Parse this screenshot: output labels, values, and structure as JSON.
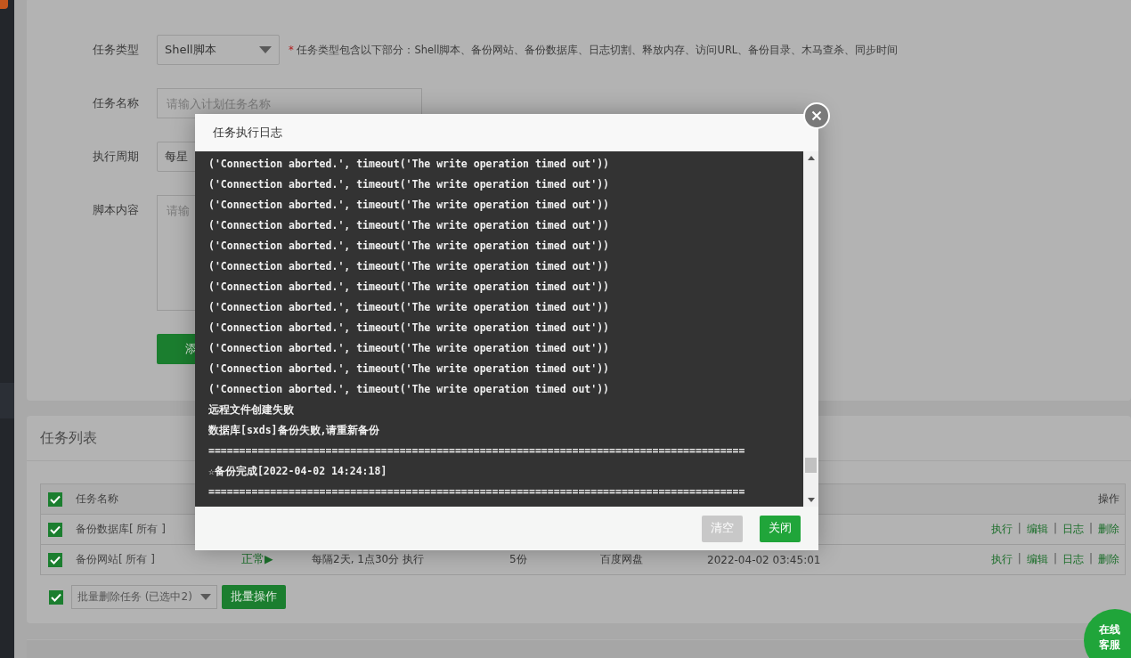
{
  "form": {
    "fields": [
      {
        "label": "任务类型",
        "kind": "select",
        "value": "Shell脚本",
        "note_mark": "*",
        "note": "任务类型包含以下部分：Shell脚本、备份网站、备份数据库、日志切割、释放内存、访问URL、备份目录、木马查杀、同步时间"
      },
      {
        "label": "任务名称",
        "kind": "input",
        "placeholder": "请输入计划任务名称"
      },
      {
        "label": "执行周期",
        "kind": "select",
        "value": "每星"
      },
      {
        "label": "脚本内容",
        "kind": "textarea",
        "placeholder": "请输"
      }
    ],
    "submit": "添"
  },
  "task_list": {
    "title": "任务列表",
    "columns": [
      {
        "label": "任务名称"
      },
      {
        "label": "操作"
      }
    ],
    "header_checked": true,
    "action_separator": "|",
    "rows": [
      {
        "checked": true,
        "name": "备份数据库[ 所有 ]",
        "actions": [
          "执行",
          "编辑",
          "日志",
          "删除"
        ]
      },
      {
        "checked": true,
        "name": "备份网站[ 所有 ]",
        "status": "正常▶",
        "period": "每隔2天, 1点30分 执行",
        "keep": "5份",
        "target": "百度网盘",
        "last_run": "2022-04-02 03:45:01",
        "actions": [
          "执行",
          "编辑",
          "日志",
          "删除"
        ]
      }
    ],
    "footer": {
      "checked": true,
      "batch_select": "批量删除任务 (已选中2)",
      "batch_button": "批量操作"
    }
  },
  "modal": {
    "title": "任务执行日志",
    "log": [
      "('Connection aborted.', timeout('The write operation timed out'))",
      "('Connection aborted.', timeout('The write operation timed out'))",
      "('Connection aborted.', timeout('The write operation timed out'))",
      "('Connection aborted.', timeout('The write operation timed out'))",
      "('Connection aborted.', timeout('The write operation timed out'))",
      "('Connection aborted.', timeout('The write operation timed out'))",
      "('Connection aborted.', timeout('The write operation timed out'))",
      "('Connection aborted.', timeout('The write operation timed out'))",
      "('Connection aborted.', timeout('The write operation timed out'))",
      "('Connection aborted.', timeout('The write operation timed out'))",
      "('Connection aborted.', timeout('The write operation timed out'))",
      "('Connection aborted.', timeout('The write operation timed out'))",
      "远程文件创建失败",
      "数据库[sxds]备份失败,请重新备份",
      "=======================================================================================",
      "☆备份完成[2022-04-02 14:24:18]",
      "======================================================================================="
    ],
    "buttons": [
      {
        "label": "清空",
        "kind": "secondary"
      },
      {
        "label": "关闭",
        "kind": "primary"
      }
    ]
  },
  "chat_badge": [
    "在线",
    "客服"
  ]
}
